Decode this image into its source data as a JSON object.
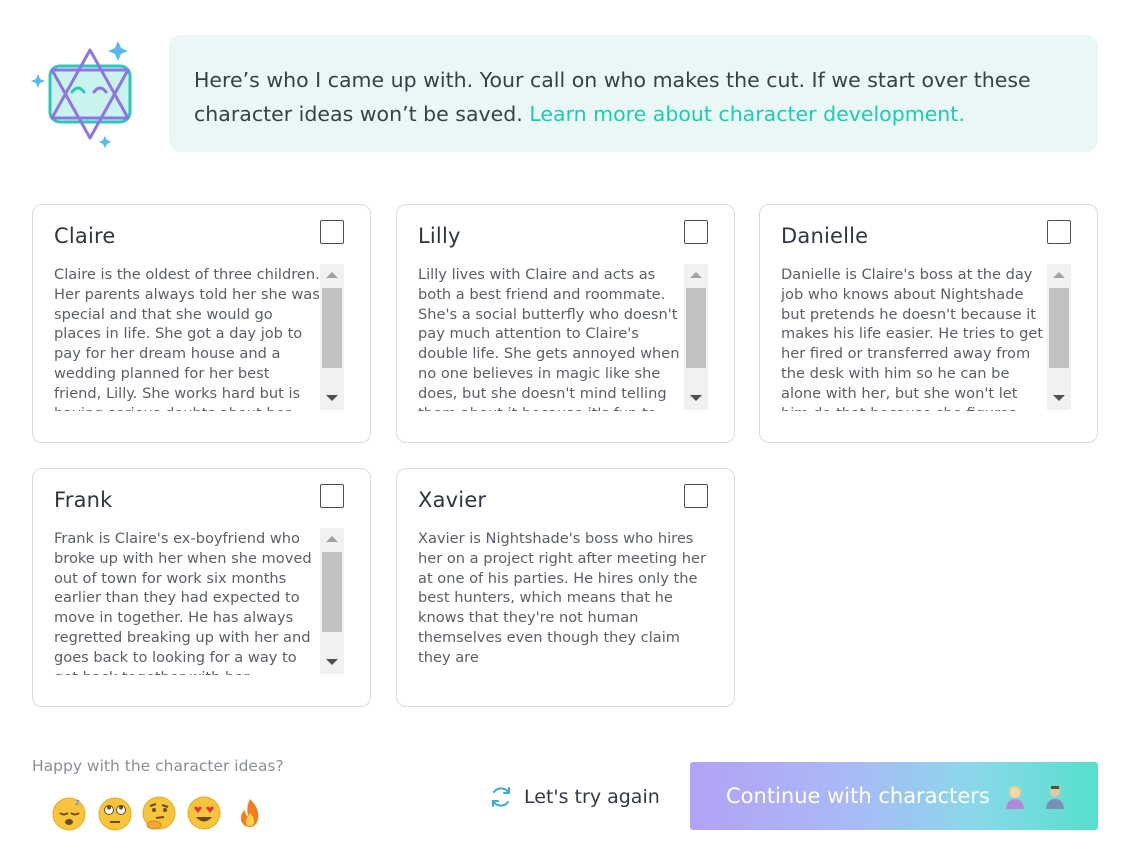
{
  "intro": {
    "text": "Here’s who I came up with. Your call on who makes the cut. If we start over these character ideas won’t be saved.",
    "link": "Learn more about character development."
  },
  "characters": [
    {
      "name": "Claire",
      "description": "Claire is the oldest of three children. Her parents always told her she was special and that she would go places in life. She got a day job to pay for her dream house and a wedding planned for her best friend, Lilly. She works hard but is having serious doubts about her future.",
      "checked": false
    },
    {
      "name": "Lilly",
      "description": "Lilly lives with Claire and acts as both a best friend and roommate. She's a social butterfly who doesn't pay much attention to Claire's double life. She gets annoyed when no one believes in magic like she does, but she doesn't mind telling them about it because it's fun to watch their reactions.",
      "checked": false
    },
    {
      "name": "Danielle",
      "description": "Danielle is Claire's boss at the day job who knows about Nightshade but pretends he doesn't because it makes his life easier. He tries to get her fired or transferred away from the desk with him so he can be alone with her, but she won't let him do that because she figures he'll get bored eventually.",
      "checked": false
    },
    {
      "name": "Frank",
      "description": "Frank is Claire's ex-boyfriend who broke up with her when she moved out of town for work six months earlier than they had expected to move in together. He has always regretted breaking up with her and goes back to looking for a way to get back together with her.",
      "checked": false
    },
    {
      "name": "Xavier",
      "description": "Xavier is Nightshade's boss who hires her on a project right after meeting her at one of his parties. He hires only the best hunters, which means that he knows that they're not human themselves even though they claim they are",
      "checked": false
    }
  ],
  "feedback": {
    "label": "Happy with the character ideas?",
    "emojis": [
      "sleepy-face-icon",
      "eye-roll-face-icon",
      "thinking-face-icon",
      "heart-eyes-face-icon",
      "fire-icon"
    ]
  },
  "actions": {
    "retry_label": "Let's try again",
    "continue_label": "Continue with characters"
  },
  "colors": {
    "accent": "#1dcbb0",
    "intro_bg": "#e9f8f6",
    "continue_gradient_start": "#b3a2f6",
    "continue_gradient_end": "#55e0cc"
  }
}
